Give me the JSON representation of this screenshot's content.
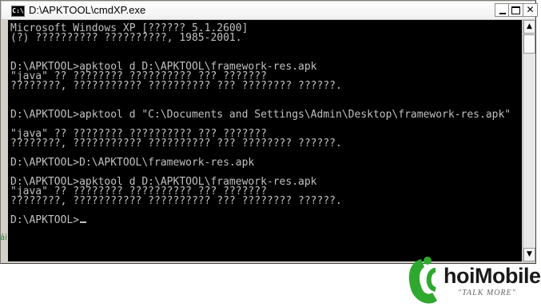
{
  "window": {
    "title": "D:\\APKTOOL\\cmdXP.exe",
    "icon_label": "C:\\",
    "buttons": {
      "minimize": "minimize-icon",
      "maximize": "maximize-icon",
      "close": "✕"
    }
  },
  "console": {
    "lines": [
      "Microsoft Windows XP [?????? 5.1.2600]",
      "(?) ?????????? ??????????, 1985-2001.",
      "",
      "D:\\APKTOOL>apktool d D:\\APKTOOL\\framework-res.apk",
      "\"java\" ?? ???????? ?????????? ??? ???????",
      "????????, ??????????? ?????????? ??? ???????? ??????.",
      "",
      "D:\\APKTOOL>apktool d \"C:\\Documents and Settings\\Admin\\Desktop\\framework-res.apk\"",
      "",
      "\"java\" ?? ???????? ?????????? ??? ???????",
      "????????, ??????????? ?????????? ??? ???????? ??????.",
      "",
      "D:\\APKTOOL>D:\\APKTOOL\\framework-res.apk",
      "",
      "D:\\APKTOOL>apktool d D:\\APKTOOL\\framework-res.apk",
      "\"java\" ?? ???????? ?????????? ??? ???????",
      "????????, ??????????? ?????????? ??? ???????? ??????.",
      "",
      "D:\\APKTOOL>"
    ]
  },
  "scrollbar": {
    "up_arrow": "▲",
    "down_arrow": "▼"
  },
  "logo": {
    "brand": "hoiMobile",
    "slogan": "\"TALK MORE\""
  },
  "colors": {
    "console_bg": "#000000",
    "console_text": "#c0c0c0",
    "logo_green": "#2fa82f"
  }
}
